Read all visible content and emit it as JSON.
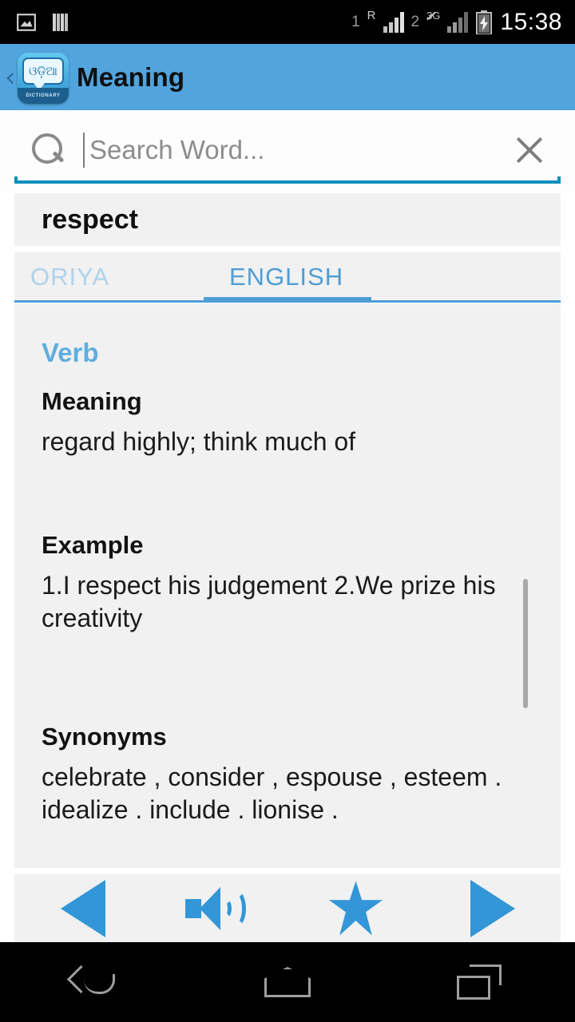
{
  "status_bar": {
    "left_icons": [
      "image-icon",
      "bars-icon"
    ],
    "sim1_number": "1",
    "sim1_network": "R",
    "sim2_number": "2",
    "sim2_network": "3G",
    "battery": "charging",
    "clock": "15:38"
  },
  "app_bar": {
    "back_label": "‹",
    "icon_script_text": "ଓଡ଼ିଆ",
    "icon_band_text": "DICTIONARY",
    "title": "Meaning",
    "background_color": "#51a4dd"
  },
  "search": {
    "placeholder": "Search Word...",
    "value": "",
    "clear_label": "✕",
    "underline_color": "#0d8fbd"
  },
  "word": {
    "text": "respect"
  },
  "tabs": [
    {
      "label": "ORIYA",
      "active": false
    },
    {
      "label": "ENGLISH",
      "active": true
    }
  ],
  "content": {
    "part_of_speech": "Verb",
    "sections": [
      {
        "heading": "Meaning",
        "body": "regard highly; think much of"
      },
      {
        "heading": "Example",
        "body": "1.I respect his judgement 2.We prize his creativity"
      },
      {
        "heading": "Synonyms",
        "body": "celebrate , consider , espouse , esteem . idealize . include . lionise ."
      }
    ]
  },
  "action_bar": {
    "buttons": [
      {
        "name": "previous-word",
        "icon": "triangle-left-icon"
      },
      {
        "name": "pronounce",
        "icon": "speaker-icon"
      },
      {
        "name": "favorite",
        "icon": "star-icon"
      },
      {
        "name": "next-word",
        "icon": "triangle-right-icon"
      }
    ],
    "accent_color": "#3296d8"
  },
  "nav_bar": {
    "buttons": [
      {
        "name": "android-back",
        "icon": "back-arrow-icon"
      },
      {
        "name": "android-home",
        "icon": "home-icon"
      },
      {
        "name": "android-recents",
        "icon": "recents-icon"
      }
    ]
  }
}
